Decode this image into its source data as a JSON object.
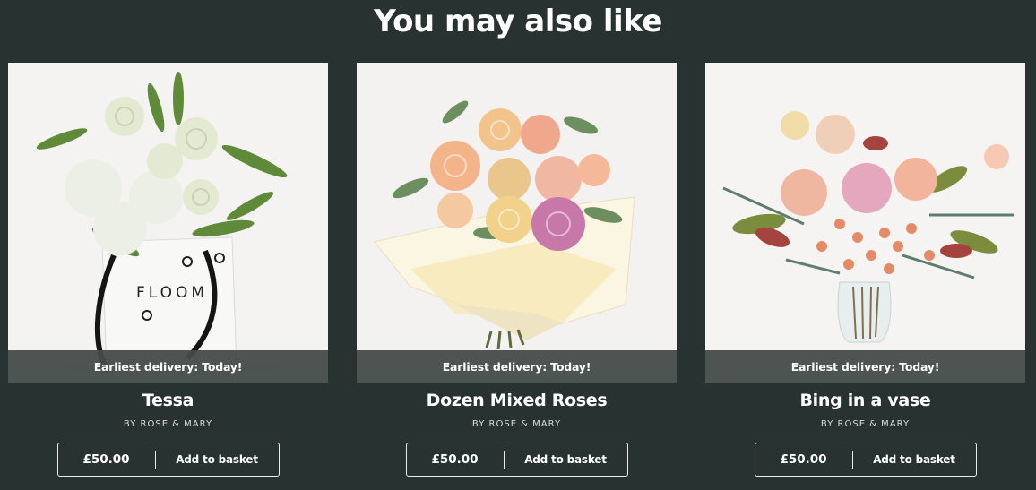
{
  "section": {
    "title": "You may also like"
  },
  "products": [
    {
      "name": "Tessa",
      "vendor": "BY ROSE & MARY",
      "delivery": "Earliest delivery: Today!",
      "price": "£50.00",
      "cta": "Add to basket",
      "bag_text": "FLOOM"
    },
    {
      "name": "Dozen Mixed Roses",
      "vendor": "BY ROSE & MARY",
      "delivery": "Earliest delivery: Today!",
      "price": "£50.00",
      "cta": "Add to basket"
    },
    {
      "name": "Bing in a vase",
      "vendor": "BY ROSE & MARY",
      "delivery": "Earliest delivery: Today!",
      "price": "£50.00",
      "cta": "Add to basket"
    }
  ],
  "colors": {
    "background": "#283230",
    "banner": "#444b48",
    "text": "#ffffff"
  }
}
